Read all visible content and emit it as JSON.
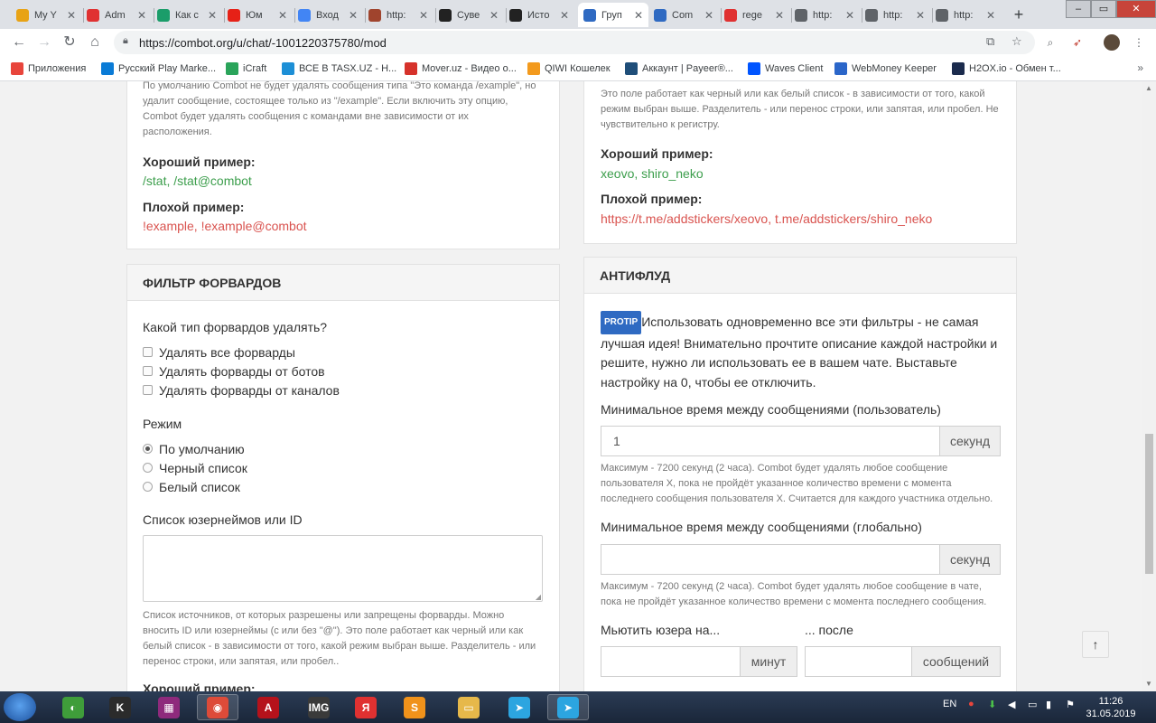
{
  "browser": {
    "tabs": [
      {
        "title": "My Y",
        "favicon": "youtube-grid-favicon",
        "color": "#e8a315"
      },
      {
        "title": "Adm",
        "favicon": "yandex-favicon",
        "color": "#e03131"
      },
      {
        "title": "Как с",
        "favicon": "circle-favicon",
        "color": "#1b9d6a"
      },
      {
        "title": "Юм",
        "favicon": "youtube-favicon",
        "color": "#e62117"
      },
      {
        "title": "Вход",
        "favicon": "google-favicon",
        "color": "#4285f4"
      },
      {
        "title": "http:",
        "favicon": "gear-favicon",
        "color": "#a0442d"
      },
      {
        "title": "Суве",
        "favicon": "t-favicon",
        "color": "#222222"
      },
      {
        "title": "Исто",
        "favicon": "t-favicon",
        "color": "#222222"
      },
      {
        "title": "Груп",
        "favicon": "combot-favicon",
        "color": "#2f6ac2"
      },
      {
        "title": "Com",
        "favicon": "combot-favicon",
        "color": "#2f6ac2"
      },
      {
        "title": "rege",
        "favicon": "yandex-favicon",
        "color": "#e03131"
      },
      {
        "title": "http:",
        "favicon": "globe-favicon",
        "color": "#5f6368"
      },
      {
        "title": "http:",
        "favicon": "globe-favicon",
        "color": "#5f6368"
      },
      {
        "title": "http:",
        "favicon": "globe-favicon",
        "color": "#5f6368"
      }
    ],
    "active_tab": 8,
    "url": "https://combot.org/u/chat/-1001220375780/mod",
    "bookmarks": [
      {
        "label": "Приложения",
        "icon": "apps-grid-icon",
        "color": "#e8453c"
      },
      {
        "label": "Русский Play Marke...",
        "icon": "play-market-icon",
        "color": "#0a7bd6"
      },
      {
        "label": "iCraft",
        "icon": "icraft-icon",
        "color": "#2aa45a"
      },
      {
        "label": "ВСЕ В TASX.UZ - Н...",
        "icon": "tasx-icon",
        "color": "#1d8fd6"
      },
      {
        "label": "Mover.uz - Видео о...",
        "icon": "mover-icon",
        "color": "#d6322b"
      },
      {
        "label": "QIWI Кошелек",
        "icon": "qiwi-icon",
        "color": "#f39a1d"
      },
      {
        "label": "Аккаунт | Payeer®...",
        "icon": "payeer-icon",
        "color": "#1f4e79"
      },
      {
        "label": "Waves Client",
        "icon": "waves-icon",
        "color": "#0055ff"
      },
      {
        "label": "WebMoney Keeper",
        "icon": "webmoney-icon",
        "color": "#2b66c9"
      },
      {
        "label": "H2OX.io - Обмен т...",
        "icon": "h2ox-icon",
        "color": "#1b2b4d"
      }
    ]
  },
  "left_top_card": {
    "help": "По умолчанию Combot не будет удалять сообщения типа \"Это команда /example\", но удалит сообщение, состоящее только из \"/example\". Если включить эту опцию, Combot будет удалять сообщения с командами вне зависимости от их расположения.",
    "good_title": "Хороший пример:",
    "good_value": "/stat, /stat@combot",
    "bad_title": "Плохой пример:",
    "bad_value": "!example, !example@combot"
  },
  "right_top_card": {
    "help": "Это поле работает как черный или как белый список - в зависимости от того, какой режим выбран выше. Разделитель - или перенос строки, или запятая, или пробел. Не чувствительно к регистру.",
    "good_title": "Хороший пример:",
    "good_value": "xeovo, shiro_neko",
    "bad_title": "Плохой пример:",
    "bad_value": "https://t.me/addstickers/xeovo, t.me/addstickers/shiro_neko"
  },
  "forward_filter": {
    "title": "ФИЛЬТР ФОРВАРДОВ",
    "type_question": "Какой тип форвардов удалять?",
    "checkboxes": [
      "Удалять все форварды",
      "Удалять форварды от ботов",
      "Удалять форварды от каналов"
    ],
    "mode_label": "Режим",
    "modes": [
      "По умолчанию",
      "Черный список",
      "Белый список"
    ],
    "selected_mode": 0,
    "list_label": "Список юзернеймов или ID",
    "list_value": "",
    "list_help": "Список источников, от которых разрешены или запрещены форварды. Можно вносить ID или юзернеймы (с или без \"@\"). Это поле работает как черный или как белый список - в зависимости от того, какой режим выбран выше. Разделитель - или перенос строки, или запятая, или пробел..",
    "good_title": "Хороший пример:"
  },
  "antiflood": {
    "title": "АНТИФЛУД",
    "protip_badge": "PROTIP",
    "protip_text": "Использовать одновременно все эти фильтры - не самая лучшая идея! Внимательно прочтите описание каждой настройки и решите, нужно ли использовать ее в вашем чате. Выставьте настройку на 0, чтобы ее отключить.",
    "user_interval_label": "Минимальное время между сообщениями (пользователь)",
    "user_interval_value": "1",
    "user_interval_unit": "секунд",
    "user_interval_help": "Максимум - 7200 секунд (2 часа). Combot будет удалять любое сообщение пользователя X, пока не пройдёт указанное количество времени с момента последнего сообщения пользователя X. Считается для каждого участника отдельно.",
    "global_interval_label": "Минимальное время между сообщениями (глобально)",
    "global_interval_value": "",
    "global_interval_unit": "секунд",
    "global_interval_help": "Максимум - 7200 секунд (2 часа). Combot будет удалять любое сообщение в чате, пока не пройдёт указанное количество времени с момента последнего сообщения.",
    "mute_label": "Мьютить юзера на...",
    "mute_value": "",
    "mute_unit": "минут",
    "after_label": "... после",
    "after_value": "",
    "after_unit": "сообщений"
  },
  "scroll_top_label": "↑",
  "taskbar": {
    "apps": [
      {
        "name": "start-button"
      },
      {
        "name": "sticker-app-icon",
        "color": "#3f9d3a",
        "glyph": "◐"
      },
      {
        "name": "kmplayer-icon",
        "color": "#2b2b2b",
        "glyph": "K"
      },
      {
        "name": "winrar-icon",
        "color": "#8e2a7c",
        "glyph": "▦"
      },
      {
        "name": "chrome-icon",
        "color": "#dd4b39",
        "glyph": "◉"
      },
      {
        "name": "acrobat-icon",
        "color": "#b5121b",
        "glyph": "A"
      },
      {
        "name": "img-ed-icon",
        "color": "#3a3a3a",
        "glyph": "IMG"
      },
      {
        "name": "yandex-browser-icon",
        "color": "#e03131",
        "glyph": "Я"
      },
      {
        "name": "sublime-icon",
        "color": "#f0921b",
        "glyph": "S"
      },
      {
        "name": "explorer-icon",
        "color": "#e6b84a",
        "glyph": "▭"
      },
      {
        "name": "telegram-icon",
        "color": "#2ca5e0",
        "glyph": "➤"
      },
      {
        "name": "telegram-desktop-icon",
        "color": "#2ca5e0",
        "glyph": "➤"
      }
    ],
    "language": "EN",
    "time": "11:26",
    "date": "31.05.2019"
  }
}
